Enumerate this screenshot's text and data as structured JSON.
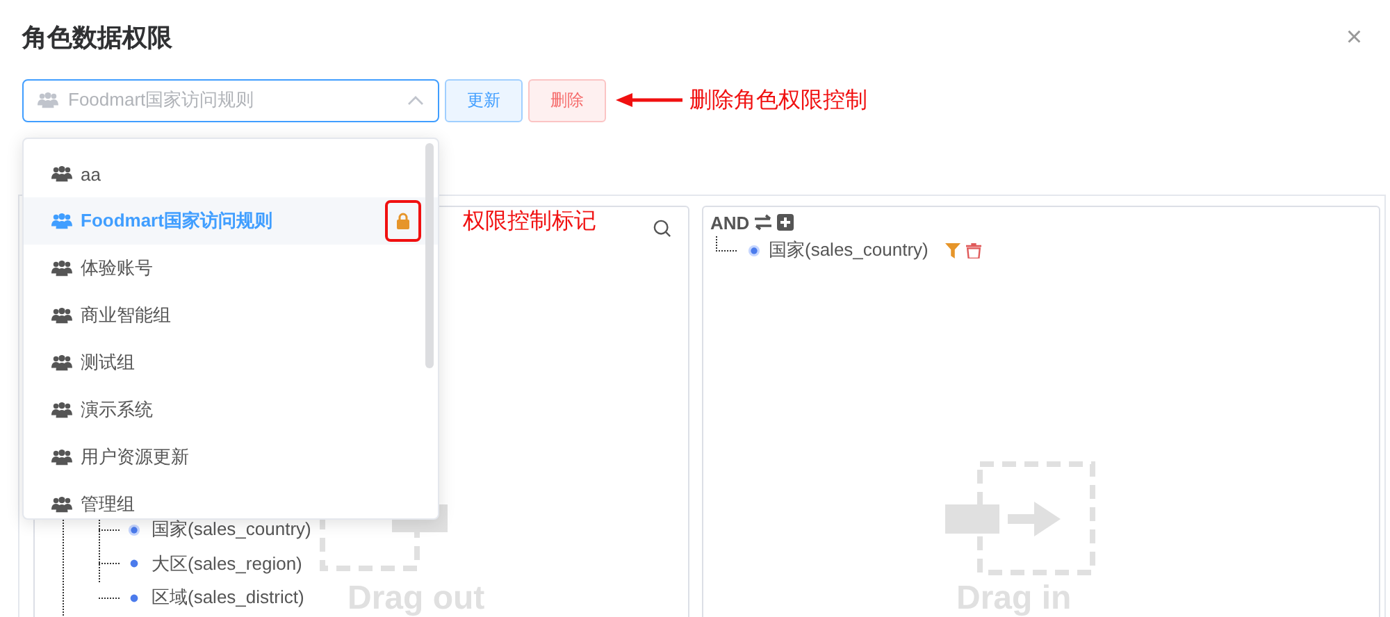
{
  "dialog": {
    "title": "角色数据权限",
    "close": "×"
  },
  "role_select": {
    "value": "Foodmart国家访问规则",
    "expanded": true
  },
  "buttons": [
    {
      "label": "更新",
      "kind": "update"
    },
    {
      "label": "删除",
      "kind": "delete"
    }
  ],
  "annotations": [
    {
      "text": "删除角色权限控制"
    },
    {
      "text": "权限控制标记"
    }
  ],
  "dropdown": {
    "items": [
      {
        "label": "aa",
        "selected": false,
        "locked": false
      },
      {
        "label": "Foodmart国家访问规则",
        "selected": true,
        "locked": true
      },
      {
        "label": "体验账号",
        "selected": false,
        "locked": false
      },
      {
        "label": "商业智能组",
        "selected": false,
        "locked": false
      },
      {
        "label": "测试组",
        "selected": false,
        "locked": false
      },
      {
        "label": "演示系统",
        "selected": false,
        "locked": false
      },
      {
        "label": "用户资源更新",
        "selected": false,
        "locked": false
      },
      {
        "label": "管理组",
        "selected": false,
        "locked": false
      }
    ]
  },
  "field_tree": {
    "items": [
      {
        "label": "国家(sales_country)",
        "selected": true
      },
      {
        "label": "大区(sales_region)",
        "selected": false
      },
      {
        "label": "区域(sales_district)",
        "selected": false
      }
    ]
  },
  "drag_out": {
    "label": "Drag out"
  },
  "condition": {
    "operator": "AND",
    "items": [
      {
        "label": "国家(sales_country)"
      }
    ]
  },
  "drag_in": {
    "label": "Drag in"
  }
}
